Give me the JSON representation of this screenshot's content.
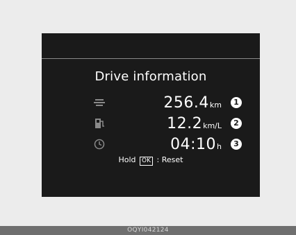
{
  "display": {
    "title": "Drive information",
    "rows": [
      {
        "icon": "route-distance-icon",
        "value": "256.4",
        "unit": "km",
        "marker": "1"
      },
      {
        "icon": "fuel-pump-icon",
        "value": "12.2",
        "unit": "km/L",
        "marker": "2"
      },
      {
        "icon": "clock-icon",
        "value": "04:10",
        "unit": "h",
        "marker": "3"
      }
    ],
    "reset": {
      "prefix": "Hold",
      "key": "OK",
      "suffix": ": Reset"
    }
  },
  "footer": {
    "code": "OQYI042124"
  },
  "colors": {
    "page_background": "#ececec",
    "screen_background": "#1a1a1a",
    "text": "#ffffff",
    "icon": "#8a8a8a",
    "footer_bar": "#6f6f6f"
  }
}
